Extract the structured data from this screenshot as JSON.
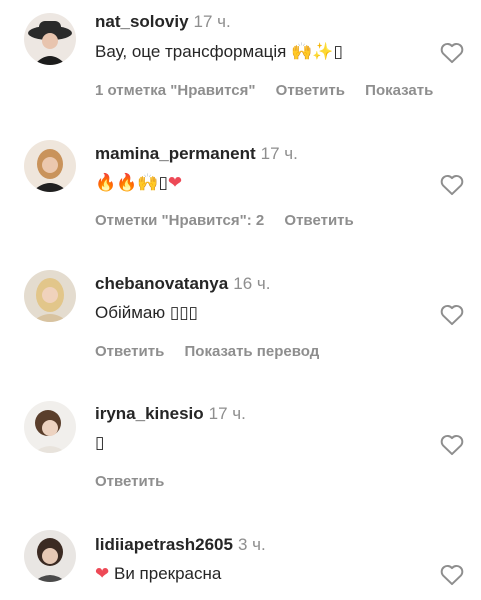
{
  "colors": {
    "text": "#262626",
    "muted": "#8e8e8e",
    "heart_red": "#ed4956"
  },
  "comments": [
    {
      "username": "nat_soloviy",
      "time": "17 ч.",
      "text": "Вау, оце трансформація",
      "emojis": [
        "🙌",
        "✨",
        "▯"
      ],
      "actions": [
        "1 отметка \"Нравится\"",
        "Ответить",
        "Показать"
      ],
      "like_icon": "heart-outline-icon"
    },
    {
      "username": "mamina_permanent",
      "time": "17 ч.",
      "text": "",
      "emojis": [
        "🔥",
        "🔥",
        "🙌",
        "▯",
        "❤"
      ],
      "actions": [
        "Отметки \"Нравится\": 2",
        "Ответить"
      ],
      "like_icon": "heart-outline-icon"
    },
    {
      "username": "chebanovatanya",
      "time": "16 ч.",
      "text": "Обіймаю ▯▯▯",
      "emojis": [],
      "actions": [
        "Ответить",
        "Показать перевод"
      ],
      "like_icon": "heart-outline-icon"
    },
    {
      "username": "iryna_kinesio",
      "time": "17 ч.",
      "text": "▯",
      "emojis": [],
      "actions": [
        "Ответить"
      ],
      "like_icon": "heart-outline-icon"
    },
    {
      "username": "lidiiapetrash2605",
      "time": "3 ч.",
      "text": "Ви прекрасна",
      "emojis": [
        "❤"
      ],
      "actions": [],
      "like_icon": "heart-outline-icon"
    }
  ]
}
